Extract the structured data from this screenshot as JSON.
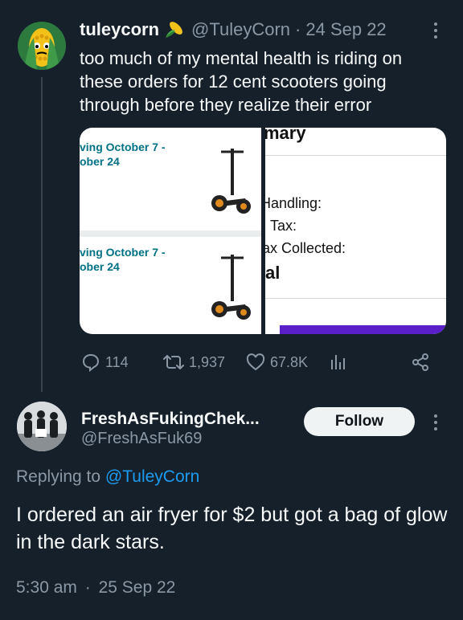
{
  "tweet": {
    "display_name": "tuleycorn",
    "handle": "@TuleyCorn",
    "separator": "·",
    "date": "24 Sep 22",
    "text": "too much of my mental health is riding on these orders for 12 cent scooters going through before they realize their error",
    "media": {
      "left_panel": {
        "item1_line1": "ving October 7 -",
        "item1_line2": "ober 24",
        "item2_line1": "ving October 7 -",
        "item2_line2": "ober 24"
      },
      "right_panel": {
        "heading": "mary",
        "handling": "Handling:",
        "tax": "Tax:",
        "tax_collected": "ax Collected:",
        "total": "al"
      }
    },
    "stats": {
      "replies": "114",
      "retweets": "1,937",
      "likes": "67.8K"
    }
  },
  "reply": {
    "display_name": "FreshAsFukingChek...",
    "handle": "@FreshAsFuk69",
    "follow_label": "Follow",
    "replying_prefix": "Replying to",
    "replying_to": "@TuleyCorn",
    "text": "I ordered an air fryer for $2 but got a bag of glow in the dark stars.",
    "time": "5:30 am",
    "separator": "·",
    "date": "25 Sep 22"
  },
  "colors": {
    "background": "#15202b",
    "accent": "#1d9bf0",
    "muted": "#8b98a5",
    "amazon_green": "#007185",
    "amazon_purple": "#5a1fc9"
  }
}
